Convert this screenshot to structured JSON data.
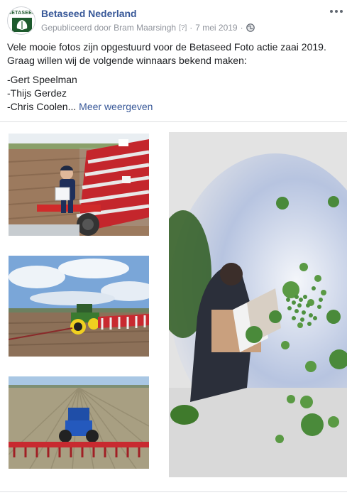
{
  "header": {
    "page_name": "Betaseed Nederland",
    "avatar_text": "BETASEED",
    "published_by": "Gepubliceerd door Bram Maarsingh",
    "help_marker": "[?]",
    "separator": "·",
    "date": "7 mei 2019",
    "separator2": "·",
    "privacy_icon": "globe-icon",
    "more_icon": "more-options-icon"
  },
  "post": {
    "paragraph1": "Vele mooie fotos zijn opgestuurd voor de Betaseed Foto actie zaai 2019. Graag willen wij de volgende winnaars bekend maken:",
    "winners": [
      "-Gert Speelman",
      "-Thijs Gerdez",
      "-Chris Coolen..."
    ],
    "see_more": "Meer weergeven"
  },
  "photos": [
    {
      "description_icon": "boy-with-seed-box-photo"
    },
    {
      "description_icon": "green-tractor-photo"
    },
    {
      "description_icon": "blue-tractor-photo"
    },
    {
      "description_icon": "seeds-falling-photo"
    }
  ],
  "colors": {
    "link": "#385898",
    "meta": "#90949c",
    "text": "#1c1e21",
    "brand_green": "#1d5a2d"
  }
}
